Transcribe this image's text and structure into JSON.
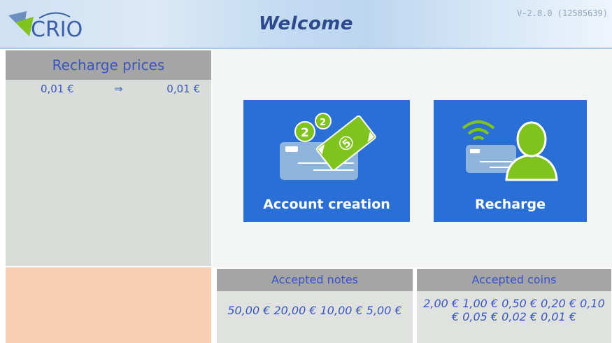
{
  "header": {
    "logo_text": "CRIO",
    "title": "Welcome",
    "version": "V-2.8.0 (12585639)"
  },
  "recharge_prices": {
    "title": "Recharge prices",
    "rows": [
      {
        "from": "0,01 €",
        "arrow": "⇒",
        "to": "0,01 €"
      }
    ]
  },
  "tiles": {
    "account_creation": {
      "label": "Account creation",
      "icon": "card-money-icon"
    },
    "recharge": {
      "label": "Recharge",
      "icon": "contactless-user-icon"
    }
  },
  "accepted_notes": {
    "title": "Accepted notes",
    "values": "50,00 € 20,00 € 10,00 € 5,00 €"
  },
  "accepted_coins": {
    "title": "Accepted coins",
    "values": "2,00 € 1,00 € 0,50 € 0,20 € 0,10 € 0,05 € 0,02 € 0,01 €"
  },
  "colors": {
    "tile_blue": "#2a6fd6",
    "text_blue": "#3a55c2",
    "icon_green": "#7fc31c",
    "panel_grey": "#a5a5a5",
    "peach": "#f8cfb3"
  }
}
